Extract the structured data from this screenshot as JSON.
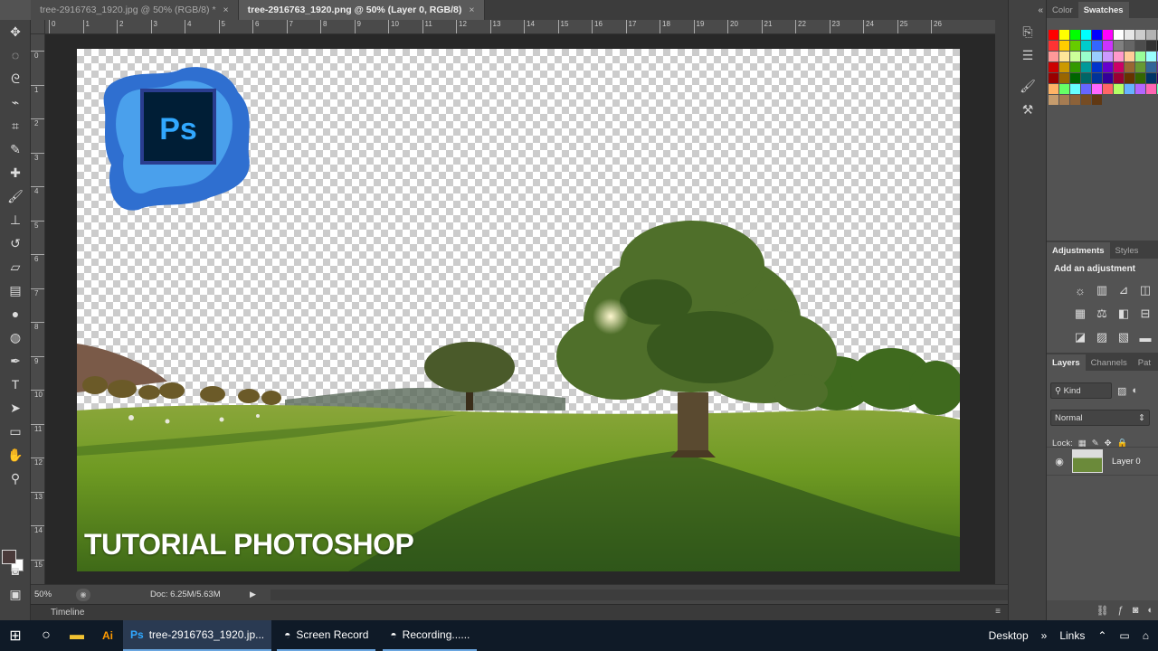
{
  "tabs": [
    {
      "label": "tree-2916763_1920.jpg @ 50% (RGB/8) *",
      "close": "×"
    },
    {
      "label": "tree-2916763_1920.png @ 50% (Layer 0, RGB/8)",
      "close": "×"
    }
  ],
  "ruler_top_ticks": [
    "0",
    "1",
    "2",
    "3",
    "4",
    "5",
    "6",
    "7",
    "8",
    "9",
    "10",
    "11",
    "12",
    "13",
    "14",
    "15",
    "16",
    "17",
    "18",
    "19",
    "20",
    "21",
    "22",
    "23",
    "24",
    "25",
    "26"
  ],
  "ruler_left_ticks": [
    "0",
    "1",
    "2",
    "3",
    "4",
    "5",
    "6",
    "7",
    "8",
    "9",
    "10",
    "11",
    "12",
    "13",
    "14",
    "15"
  ],
  "canvas": {
    "caption": "TUTORIAL PHOTOSHOP",
    "logo_text": "Ps"
  },
  "status": {
    "zoom": "50%",
    "doc": "Doc: 6.25M/5.63M",
    "arrow": "▶"
  },
  "timeline": {
    "label": "Timeline",
    "menu": "≡"
  },
  "swatches_panel": {
    "tabs": [
      "Color",
      "Swatches"
    ],
    "active": "Swatches"
  },
  "adjustments_panel": {
    "tabs": [
      "Adjustments",
      "Styles"
    ],
    "title": "Add an adjustment"
  },
  "layers_panel": {
    "tabs": [
      "Layers",
      "Channels",
      "Pat"
    ],
    "kind": "Kind",
    "blend_mode": "Normal",
    "lock_label": "Lock:",
    "layer_name": "Layer 0"
  },
  "taskbar": {
    "tasks": [
      "tree-2916763_1920.jp...",
      "Screen Record",
      "Recording......"
    ],
    "desktop": "Desktop",
    "links": "Links",
    "desktop_arrow": "»"
  },
  "colors": {
    "workspace_bg": "#282828",
    "panel_bg": "#535353",
    "taskbar_bg": "#0f1a27",
    "ps_blue": "#31a8ff",
    "ps_dark": "#001e36"
  }
}
